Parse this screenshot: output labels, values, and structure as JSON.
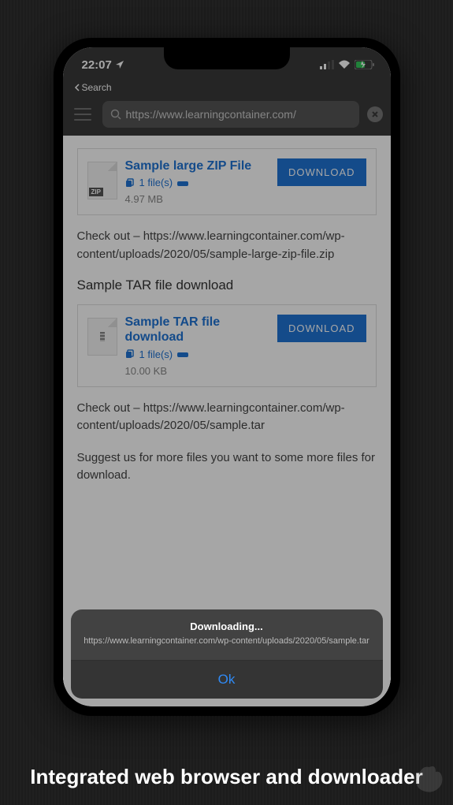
{
  "statusbar": {
    "time": "22:07",
    "back_label": "Search"
  },
  "address_bar": {
    "url": "https://www.learningcontainer.com/"
  },
  "content": {
    "card1": {
      "title": "Sample large ZIP File",
      "files": "1 file(s)",
      "size": "4.97 MB",
      "download_label": "DOWNLOAD",
      "icon_label": "ZIP"
    },
    "text1": "Check out – https://www.learningcontainer.com/wp-content/uploads/2020/05/sample-large-zip-file.zip",
    "heading2": "Sample TAR file download",
    "card2": {
      "title": "Sample TAR file download",
      "files": "1 file(s)",
      "size": "10.00 KB",
      "download_label": "DOWNLOAD"
    },
    "text2": "Check out – https://www.learningcontainer.com/wp-content/uploads/2020/05/sample.tar",
    "text3": "Suggest us for more files you want to some more files for download."
  },
  "alert": {
    "title": "Downloading...",
    "message": "https://www.learningcontainer.com/wp-content/uploads/2020/05/sample.tar",
    "ok_label": "Ok"
  },
  "caption": "Integrated web browser and downloader"
}
